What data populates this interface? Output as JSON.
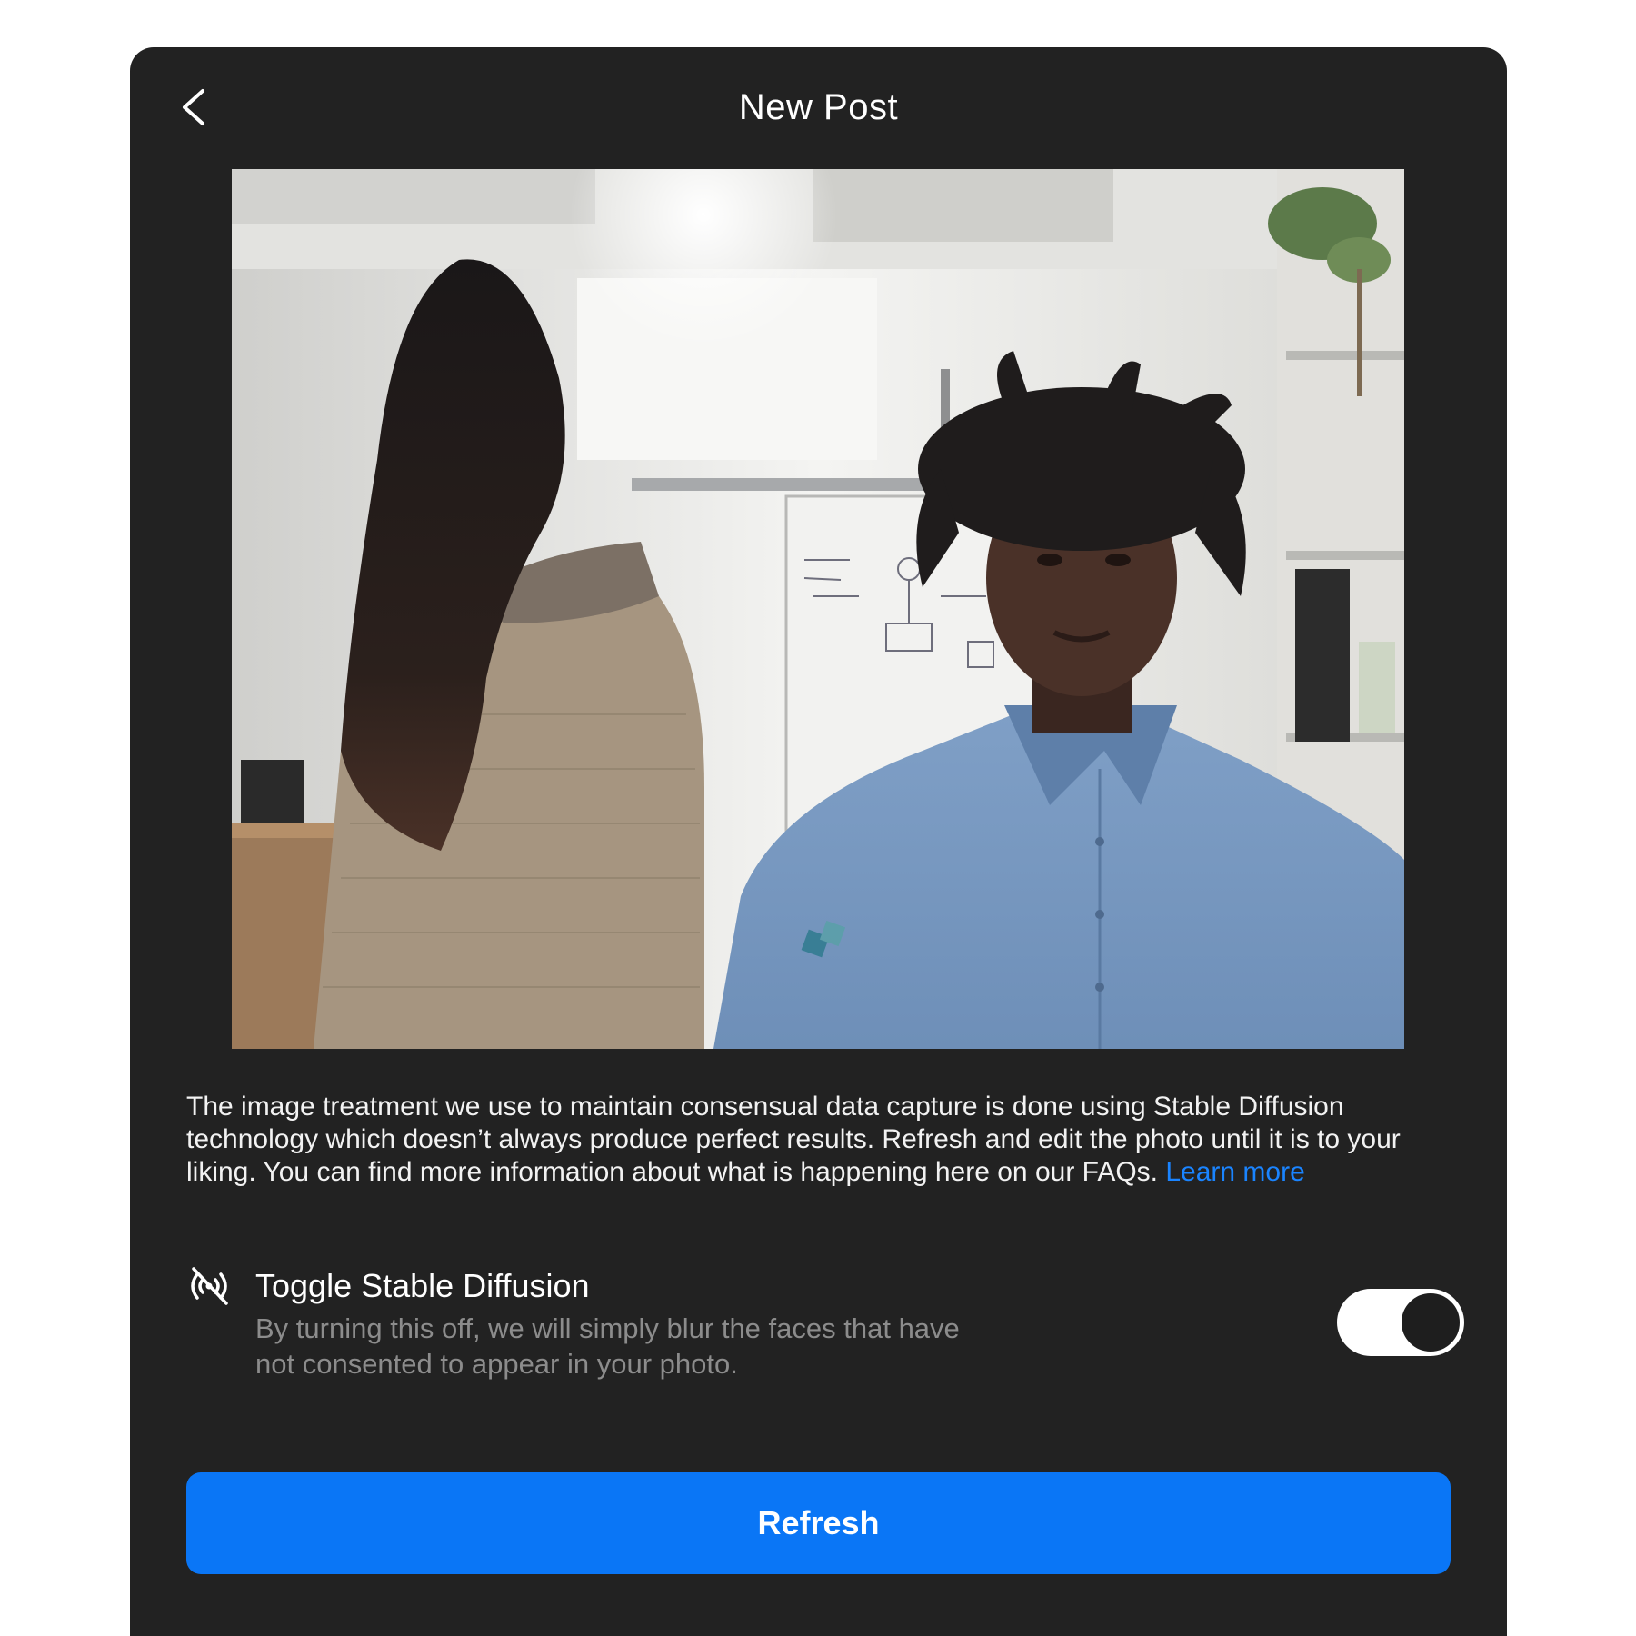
{
  "header": {
    "title": "New Post",
    "back_icon": "chevron-left-icon"
  },
  "photo": {
    "description": "Office photo of two people, one facing away"
  },
  "description": {
    "text": "The image treatment we use to maintain consensual data capture is done using Stable Diffusion technology which doesn’t always produce perfect results. Refresh and edit the photo until it is to your liking. You can find more information about what is happening here on our FAQs. ",
    "link_label": "Learn more",
    "link_color": "#1a84ff"
  },
  "stable_diffusion": {
    "icon": "broadcast-off-icon",
    "title": "Toggle Stable Diffusion",
    "description": "By turning this off, we will simply blur the faces that have not consented to appear in your photo.",
    "enabled": true
  },
  "actions": {
    "refresh_label": "Refresh",
    "refresh_color": "#0a76f6"
  },
  "colors": {
    "panel_background": "#222222",
    "page_background": "#ffffff"
  }
}
